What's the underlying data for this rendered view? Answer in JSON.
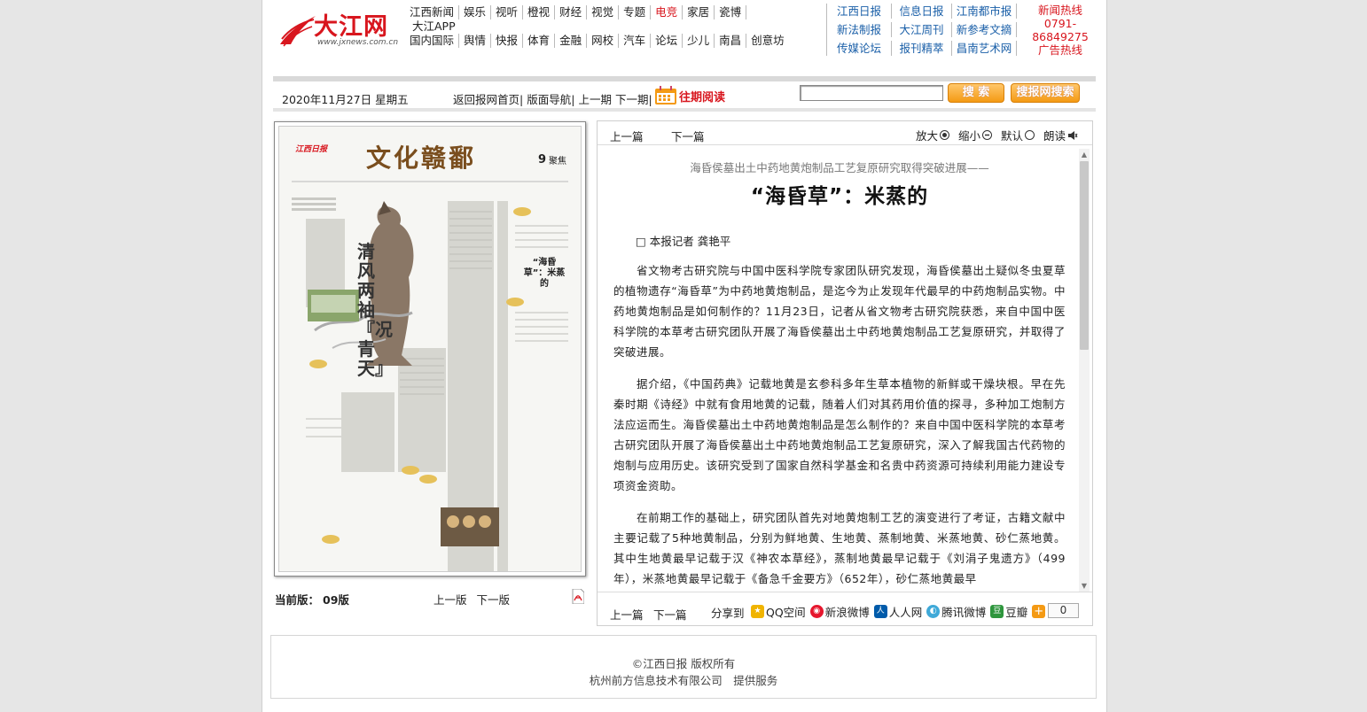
{
  "header": {
    "logo_text": "大江网",
    "logo_url": "www.jxnews.com.cn",
    "channels_row1": [
      "江西新闻",
      "娱乐",
      "视听",
      "橙视",
      "财经",
      "视觉",
      "专题",
      "电竞",
      "家居",
      "瓷博",
      "大江APP"
    ],
    "channels_row2": [
      "国内国际",
      "舆情",
      "快报",
      "体育",
      "金融",
      "网校",
      "汽车",
      "论坛",
      "少儿",
      "南昌",
      "创意坊"
    ],
    "red_channel": "电竞",
    "papers": [
      "江西日报",
      "信息日报",
      "江南都市报",
      "新法制报",
      "大江周刊",
      "新参考文摘",
      "传媒论坛",
      "报刊精萃",
      "昌南艺术网"
    ],
    "hotline": [
      "新闻热线",
      "0791-",
      "86849275",
      "广告热线"
    ]
  },
  "navbar": {
    "date": "2020年11月27日 星期五",
    "links": [
      "返回报网首页|",
      "版面导航|",
      "上一期",
      "下一期|"
    ],
    "archive": "往期阅读",
    "search_value": "",
    "search_btn": "搜 索",
    "paper_search_btn": "搜报网搜索"
  },
  "newspaper": {
    "masthead": "文化赣鄱",
    "brand": "江西日报",
    "page_no": "9",
    "section": "聚焦",
    "side_title": "清风两袖『况青天』",
    "side_article": "“海昏草”：米蒸的"
  },
  "edition": {
    "label": "当前版：",
    "number": "09版",
    "prev": "上一版",
    "next": "下一版"
  },
  "article_nav": {
    "prev": "上一篇",
    "next": "下一篇",
    "zoom_in": "放大",
    "zoom_out": "缩小",
    "default": "默认",
    "read": "朗读"
  },
  "article": {
    "pretitle": "海昏侯墓出土中药地黄炮制品工艺复原研究取得突破进展——",
    "title": "“海昏草”：米蒸的",
    "byline": "□ 本报记者 龚艳平",
    "paragraphs": [
      "省文物考古研究院与中国中医科学院专家团队研究发现，海昏侯墓出土疑似冬虫夏草的植物遗存“海昏草”为中药地黄炮制品，是迄今为止发现年代最早的中药炮制品实物。中药地黄炮制品是如何制作的？11月23日，记者从省文物考古研究院获悉，来自中国中医科学院的本草考古研究团队开展了海昏侯墓出土中药地黄炮制品工艺复原研究，并取得了突破进展。",
      "据介绍，《中国药典》记载地黄是玄参科多年生草本植物的新鲜或干燥块根。早在先秦时期《诗经》中就有食用地黄的记载，随着人们对其药用价值的探寻，多种加工炮制方法应运而生。海昏侯墓出土中药地黄炮制品是怎么制作的？来自中国中医科学院的本草考古研究团队开展了海昏侯墓出土中药地黄炮制品工艺复原研究，深入了解我国古代药物的炮制与应用历史。该研究受到了国家自然科学基金和名贵中药资源可持续利用能力建设专项资金资助。",
      "在前期工作的基础上，研究团队首先对地黄炮制工艺的演变进行了考证，古籍文献中主要记载了5种地黄制品，分别为鲜地黄、生地黄、蒸制地黄、米蒸地黄、砂仁蒸地黄。其中生地黄最早记载于汉《神农本草经》，蒸制地黄最早记载于《刘涓子鬼遗方》（499年），米蒸地黄最早记载于《备急千金要方》（652年），砂仁蒸地黄最早"
    ]
  },
  "share": {
    "label": "分享到",
    "items": [
      "QQ空间",
      "新浪微博",
      "人人网",
      "腾讯微博",
      "豆瓣"
    ],
    "count": "0"
  },
  "footer": {
    "line1": "©江西日报 版权所有",
    "line2": "杭州前方信息技术有限公司　提供服务"
  },
  "colors": {
    "brand_red": "#d8161e",
    "paper_blue": "#1a5fa8",
    "button_orange": "#f49a14"
  }
}
